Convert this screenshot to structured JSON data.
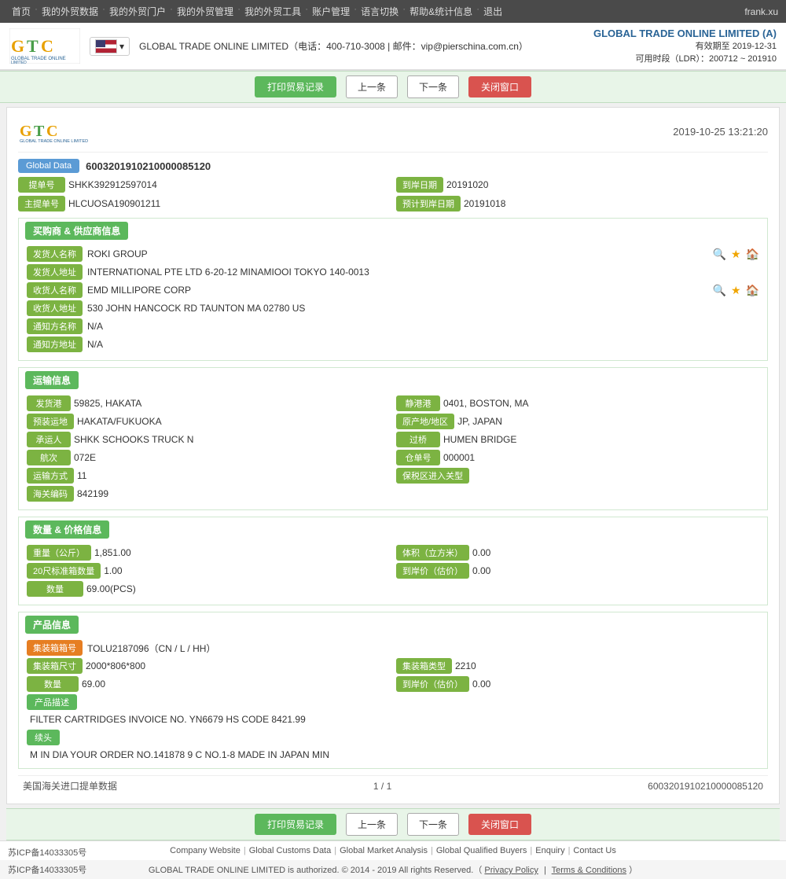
{
  "topnav": {
    "links": [
      "首页",
      "我的外贸数据",
      "我的外贸门户",
      "我的外贸管理",
      "我的外贸工具",
      "账户管理",
      "语言切换",
      "帮助&统计信息",
      "退出"
    ],
    "user": "frank.xu"
  },
  "header": {
    "company": "GLOBAL TRADE ONLINE LIMITED (A)",
    "validity": "有效期至 2019-12-31",
    "ldr": "可用时段（LDR）：200712 ~ 201910",
    "contact_name": "GLOBAL TRADE ONLINE LIMITED",
    "phone": "电话：400-710-3008",
    "email": "邮件：vip@pierschina.com.cn"
  },
  "toolbar": {
    "print": "打印贸易记录",
    "prev": "上一条",
    "next": "下一条",
    "close": "关闭窗口"
  },
  "document": {
    "datetime": "2019-10-25 13:21:20",
    "global_data_label": "Global Data",
    "global_data_value": "6003201910210000085120",
    "tidan_label": "提单号",
    "tidan_value": "SHKK392912597014",
    "daoan_label": "到岸日期",
    "daoan_value": "20191020",
    "zhutidan_label": "主提单号",
    "zhutidan_value": "HLCUOSA190901211",
    "yujidaoan_label": "预计到岸日期",
    "yujidaoan_value": "20191018"
  },
  "buyer_supplier": {
    "section_title": "买购商 & 供应商信息",
    "fasongname_label": "发货人名称",
    "fasongname_value": "ROKI GROUP",
    "fasongaddr_label": "发货人地址",
    "fasongaddr_value": "INTERNATIONAL PTE LTD 6-20-12 MINAMIOOI TOKYO 140-0013",
    "shouhuo_label": "收货人名称",
    "shouhuo_value": "EMD MILLIPORE CORP",
    "shouhuoaddr_label": "收货人地址",
    "shouhuoaddr_value": "530 JOHN HANCOCK RD TAUNTON MA 02780 US",
    "tongzhi_label": "通知方名称",
    "tongzhi_value": "N/A",
    "tongzhiaddr_label": "通知方地址",
    "tongzhiaddr_value": "N/A"
  },
  "transport": {
    "section_title": "运输信息",
    "fajin_label": "发货港",
    "fajin_value": "59825, HAKATA",
    "jingjin_label": "静港港",
    "jingjin_value": "0401, BOSTON, MA",
    "yuzhuangsude_label": "预装运地",
    "yuzhuangsude_value": "HAKATA/FUKUOKA",
    "chandivalue_label": "原产地/地区",
    "chandivalue_value": "JP, JAPAN",
    "chengyun_label": "承运人",
    "chengyun_value": "SHKK SCHOOKS TRUCK N",
    "guoqiao_label": "过桥",
    "guoqiao_value": "HUMEN BRIDGE",
    "hangci_label": "航次",
    "hangci_value": "072E",
    "cangku_label": "仓单号",
    "cangku_value": "000001",
    "yunshufangshi_label": "运输方式",
    "yunshufangshi_value": "11",
    "baoshuiqu_label": "保税区进入关型",
    "baoshuiqu_value": "",
    "haiguan_label": "海关编码",
    "haiguan_value": "842199"
  },
  "quantity_price": {
    "section_title": "数量 & 价格信息",
    "zhongliang_label": "重量（公斤）",
    "zhongliang_value": "1,851.00",
    "tiji_label": "体积（立方米）",
    "tiji_value": "0.00",
    "biaozhun_label": "20尺标准箱数量",
    "biaozhun_value": "1.00",
    "daojia_label": "到岸价（估价）",
    "daojia_value": "0.00",
    "shuliang_label": "数量",
    "shuliang_value": "69.00(PCS)"
  },
  "product": {
    "section_title": "产品信息",
    "jizhuanghao_label": "集装箱箱号",
    "jizhuanghao_value": "TOLU2187096（CN / L / HH）",
    "jizhuangchicun_label": "集装箱尺寸",
    "jizhuangchicun_value": "2000*806*800",
    "jizhuangleixing_label": "集装箱类型",
    "jizhuangleixing_value": "2210",
    "shuliang_label": "数量",
    "shuliang_value": "69.00",
    "daojia_label": "到岸价（估价）",
    "daojia_value": "0.00",
    "chanpinmiaoshu_label": "产品描述",
    "chanpinmiaoshu_value": "FILTER CARTRIDGES INVOICE NO. YN6679 HS CODE 8421.99",
    "tou_label": "续头",
    "tou_value": "M IN DIA YOUR ORDER NO.141878 9 C NO.1-8 MADE IN JAPAN MIN"
  },
  "pagination": {
    "source_label": "美国海关进口提单数据",
    "page_info": "1 / 1",
    "record_id": "6003201910210000085120"
  },
  "footer": {
    "icp": "苏ICP备14033305号",
    "links": [
      "Company Website",
      "Global Customs Data",
      "Global Market Analysis",
      "Global Qualified Buyers",
      "Enquiry",
      "Contact Us"
    ],
    "copyright": "GLOBAL TRADE ONLINE LIMITED is authorized. © 2014 - 2019 All rights Reserved.（",
    "privacy": "Privacy Policy",
    "pipe": "|",
    "terms": "Terms & Conditions",
    "close_paren": "）"
  }
}
